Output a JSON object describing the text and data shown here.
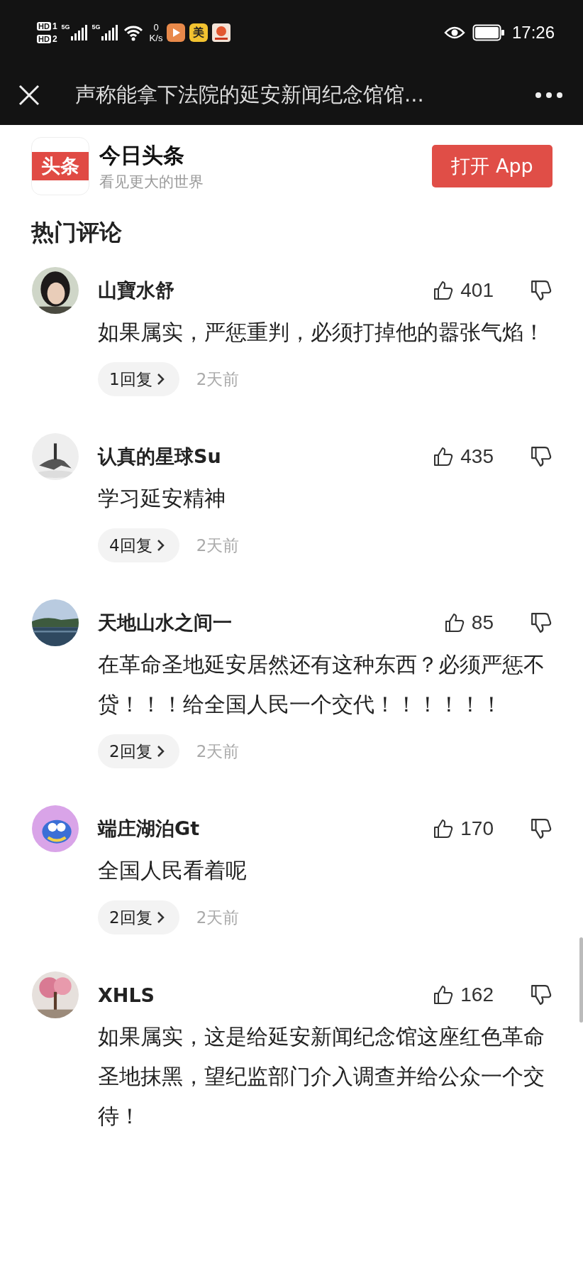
{
  "status_bar": {
    "sims": [
      {
        "label": "HD",
        "slot": "1",
        "network": "5G"
      },
      {
        "label": "HD",
        "slot": "2",
        "network": "5G"
      }
    ],
    "speed": "0",
    "speed_unit": "K/s",
    "notification_icons": [
      {
        "kind": "play"
      },
      {
        "kind": "text",
        "text": "美"
      },
      {
        "kind": "shop"
      }
    ],
    "time": "17:26"
  },
  "title_bar": {
    "title": "声称能拿下法院的延安新闻纪念馆馆..."
  },
  "app_banner": {
    "logo_text": "头条",
    "name": "今日头条",
    "slogan": "看见更大的世界",
    "button": "打开 App"
  },
  "section_title": "热门评论",
  "comments": [
    {
      "user": "山寶水舒",
      "likes": "401",
      "text": "如果属实，严惩重判，必须打掉他的嚣张气焰！",
      "replies": "1回复",
      "time": "2天前"
    },
    {
      "user": "认真的星球Su",
      "likes": "435",
      "text": "学习延安精神",
      "replies": "4回复",
      "time": "2天前"
    },
    {
      "user": "天地山水之间一",
      "likes": "85",
      "text": "在革命圣地延安居然还有这种东西？必须严惩不贷！！！给全国人民一个交代！！！！！！",
      "replies": "2回复",
      "time": "2天前"
    },
    {
      "user": "端庄湖泊Gt",
      "likes": "170",
      "text": "全国人民看着呢",
      "replies": "2回复",
      "time": "2天前"
    },
    {
      "user": "XHLS",
      "likes": "162",
      "text": "如果属实，这是给延安新闻纪念馆这座红色革命圣地抹黑，望纪监部门介入调查并给公众一个交待！"
    }
  ]
}
